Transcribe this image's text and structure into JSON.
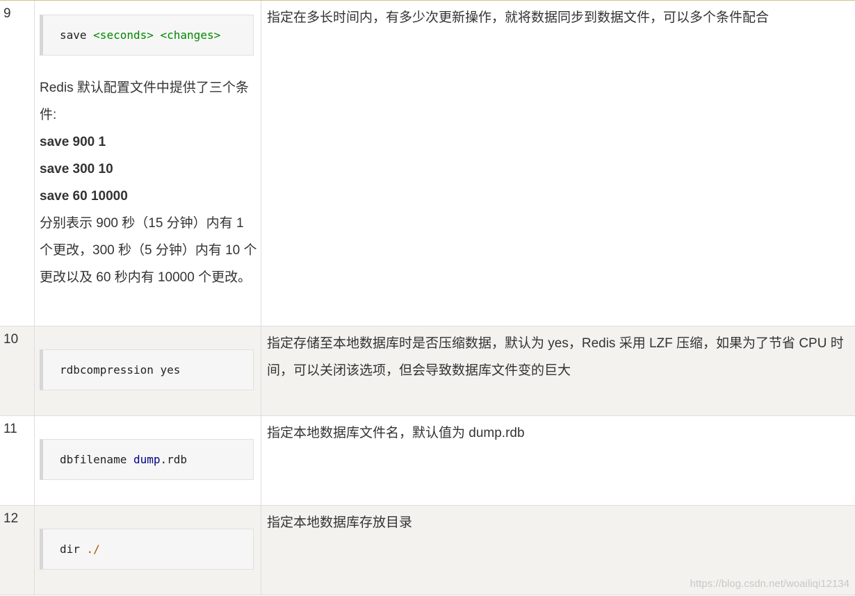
{
  "rows": [
    {
      "number": "9",
      "code": {
        "parts": [
          {
            "text": "save ",
            "style": "plain"
          },
          {
            "text": "<seconds>",
            "style": "green"
          },
          {
            "text": " ",
            "style": "plain"
          },
          {
            "text": "<changes>",
            "style": "green"
          }
        ]
      },
      "notes": {
        "intro": "Redis 默认配置文件中提供了三个条件:",
        "examples": [
          "save 900 1",
          "save 300 10",
          "save 60 10000"
        ],
        "explanation": "分别表示 900 秒（15 分钟）内有 1 个更改，300 秒（5 分钟）内有 10 个更改以及 60 秒内有 10000 个更改。"
      },
      "description": "指定在多长时间内，有多少次更新操作，就将数据同步到数据文件，可以多个条件配合"
    },
    {
      "number": "10",
      "code": {
        "parts": [
          {
            "text": "rdbcompression yes",
            "style": "plain"
          }
        ]
      },
      "description": "指定存储至本地数据库时是否压缩数据，默认为 yes，Redis 采用 LZF 压缩，如果为了节省 CPU 时间，可以关闭该选项，但会导致数据库文件变的巨大"
    },
    {
      "number": "11",
      "code": {
        "parts": [
          {
            "text": "dbfilename ",
            "style": "plain"
          },
          {
            "text": "dump",
            "style": "blue"
          },
          {
            "text": ".rdb",
            "style": "plain"
          }
        ]
      },
      "description": "指定本地数据库文件名，默认值为 dump.rdb"
    },
    {
      "number": "12",
      "code": {
        "parts": [
          {
            "text": "dir ",
            "style": "plain"
          },
          {
            "text": "./",
            "style": "orange"
          }
        ]
      },
      "description": "指定本地数据库存放目录"
    }
  ],
  "watermark": "https://blog.csdn.net/woailiqi12134",
  "colors": {
    "alt_row_bg": "#f3f2ee",
    "border": "#dddddd",
    "code_bg": "#f6f6f6",
    "code_green": "#008800",
    "code_blue": "#000080",
    "code_orange": "#aa5500"
  }
}
